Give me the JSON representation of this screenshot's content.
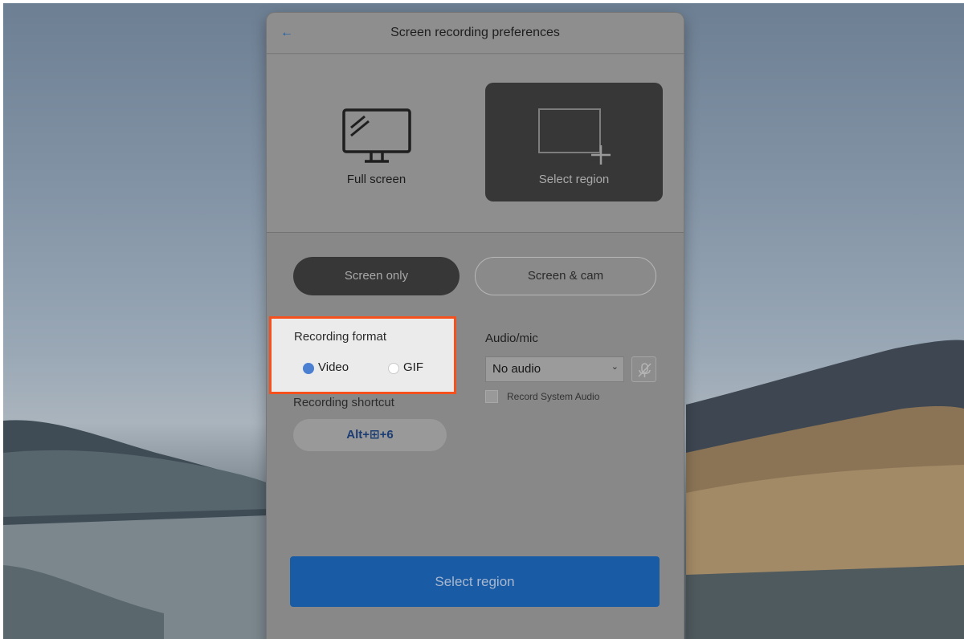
{
  "window": {
    "title": "Screen recording preferences",
    "back_icon": "arrow-left-icon"
  },
  "capture_modes": {
    "full_screen": {
      "label": "Full screen",
      "icon": "monitor-icon"
    },
    "select_region": {
      "label": "Select region",
      "icon": "region-select-icon",
      "selected": true
    }
  },
  "source": {
    "screen_only": {
      "label": "Screen only",
      "selected": true
    },
    "screen_cam": {
      "label": "Screen & cam",
      "selected": false
    }
  },
  "recording_format": {
    "label": "Recording format",
    "options": [
      {
        "label": "Video",
        "selected": true
      },
      {
        "label": "GIF",
        "selected": false
      }
    ]
  },
  "shortcut": {
    "label": "Recording shortcut",
    "value": "Alt+⊞+6"
  },
  "audio": {
    "label": "Audio/mic",
    "selected": "No audio",
    "mic_icon": "mic-muted-icon",
    "system_audio": {
      "label": "Record System Audio",
      "checked": false
    }
  },
  "primary_action": {
    "label": "Select region"
  },
  "colors": {
    "highlight_border": "#f4511e",
    "primary": "#1a5ba5",
    "radio_selected": "#4a7fd1"
  }
}
